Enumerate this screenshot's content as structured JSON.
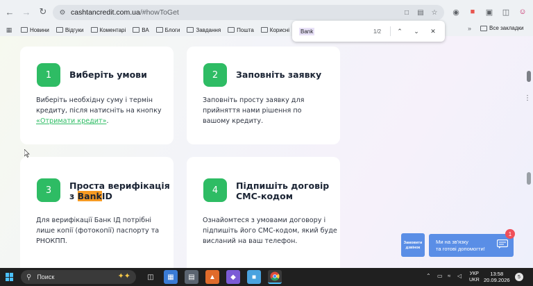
{
  "browser": {
    "url_domain": "cashtancredit.com.ua",
    "url_path": "/#howToGet",
    "bookmarks": [
      "Новини",
      "Відгуки",
      "Коментарі",
      "ВА",
      "Блоги",
      "Завдання",
      "Пошта",
      "Корисні"
    ],
    "all_bookmarks_label": "Все закладки",
    "more_label": "»"
  },
  "find": {
    "query": "Bank",
    "count": "1/2"
  },
  "steps": [
    {
      "number": "1",
      "title": "Виберіть умови",
      "body_before": "Виберіть необхідну суму і термін кредиту, після натисніть на кнопку ",
      "body_link": "«Отримати кредит»",
      "body_after": "."
    },
    {
      "number": "2",
      "title": "Заповніть заявку",
      "body": "Заповніть просту заявку для прийняття нами рішення по вашому кредиту."
    },
    {
      "number": "3",
      "title_line1": "Проста верифікація",
      "title_prefix": "з ",
      "title_highlight": "Bank",
      "title_suffix": "ID",
      "body": "Для верифікації Банк ІД потрібні лише копії (фотокопії) паспорту та РНОКПП."
    },
    {
      "number": "4",
      "title_line1": "Підпишіть договір",
      "title_line2": "СМС-кодом",
      "body": "Ознайомтеся з умовами договору і підпишіть його СМС-кодом, який буде висланий на ваш телефон."
    }
  ],
  "widgets": {
    "callback": "Замовити дзвінок",
    "chat_line1": "Ми на зв'язку",
    "chat_line2": "та готові допомогти!",
    "badge": "1"
  },
  "taskbar": {
    "search_placeholder": "Поиск",
    "lang_top": "УКР",
    "lang_bottom": "UKR",
    "time": "13:58",
    "date": "20.09.2026",
    "notifications": "5"
  },
  "colors": {
    "accent_green": "#2ebc64",
    "highlight_orange": "#f59a23",
    "widget_blue": "#5a8ee6",
    "badge_red": "#f0505a"
  }
}
